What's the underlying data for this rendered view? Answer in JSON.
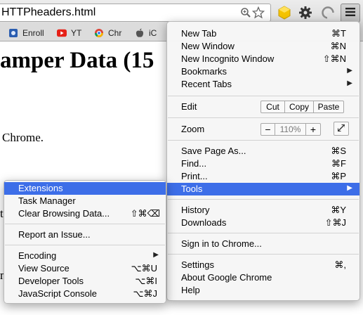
{
  "browser": {
    "url": "HTTPheaders.html",
    "colors": {
      "menu_highlight": "#3d6ee8",
      "ext_icon": "#f5c400",
      "yt_red": "#e62117"
    },
    "icons": [
      "zoom-icon",
      "star-icon",
      "extension-icon",
      "gear-icon",
      "profile-icon",
      "menu-icon"
    ]
  },
  "bookmarks": [
    {
      "label": "Enroll",
      "icon": "enroll-favicon"
    },
    {
      "label": "YT",
      "icon": "youtube-favicon"
    },
    {
      "label": "Chr",
      "icon": "chrome-favicon"
    },
    {
      "label": "iC",
      "icon": "apple-favicon"
    }
  ],
  "page": {
    "heading": "amper Data (15",
    "text": "Chrome.",
    "edge_t": "t",
    "edge_n": "n"
  },
  "main_menu": {
    "new_tab": {
      "label": "New Tab",
      "shortcut": "⌘T"
    },
    "new_window": {
      "label": "New Window",
      "shortcut": "⌘N"
    },
    "new_incognito": {
      "label": "New Incognito Window",
      "shortcut": "⇧⌘N"
    },
    "bookmarks": {
      "label": "Bookmarks"
    },
    "recent_tabs": {
      "label": "Recent Tabs"
    },
    "edit": {
      "label": "Edit",
      "cut": "Cut",
      "copy": "Copy",
      "paste": "Paste"
    },
    "zoom": {
      "label": "Zoom",
      "minus": "−",
      "value": "110%",
      "plus": "+"
    },
    "save_page": {
      "label": "Save Page As...",
      "shortcut": "⌘S"
    },
    "find": {
      "label": "Find...",
      "shortcut": "⌘F"
    },
    "print": {
      "label": "Print...",
      "shortcut": "⌘P"
    },
    "tools": {
      "label": "Tools"
    },
    "history": {
      "label": "History",
      "shortcut": "⌘Y"
    },
    "downloads": {
      "label": "Downloads",
      "shortcut": "⇧⌘J"
    },
    "sign_in": {
      "label": "Sign in to Chrome..."
    },
    "settings": {
      "label": "Settings",
      "shortcut": "⌘,"
    },
    "about": {
      "label": "About Google Chrome"
    },
    "help": {
      "label": "Help"
    }
  },
  "tools_menu": {
    "extensions": {
      "label": "Extensions"
    },
    "task_manager": {
      "label": "Task Manager"
    },
    "clear_browsing": {
      "label": "Clear Browsing Data...",
      "shortcut": "⇧⌘⌫"
    },
    "report_issue": {
      "label": "Report an Issue..."
    },
    "encoding": {
      "label": "Encoding"
    },
    "view_source": {
      "label": "View Source",
      "shortcut": "⌥⌘U"
    },
    "developer_tools": {
      "label": "Developer Tools",
      "shortcut": "⌥⌘I"
    },
    "js_console": {
      "label": "JavaScript Console",
      "shortcut": "⌥⌘J"
    }
  }
}
